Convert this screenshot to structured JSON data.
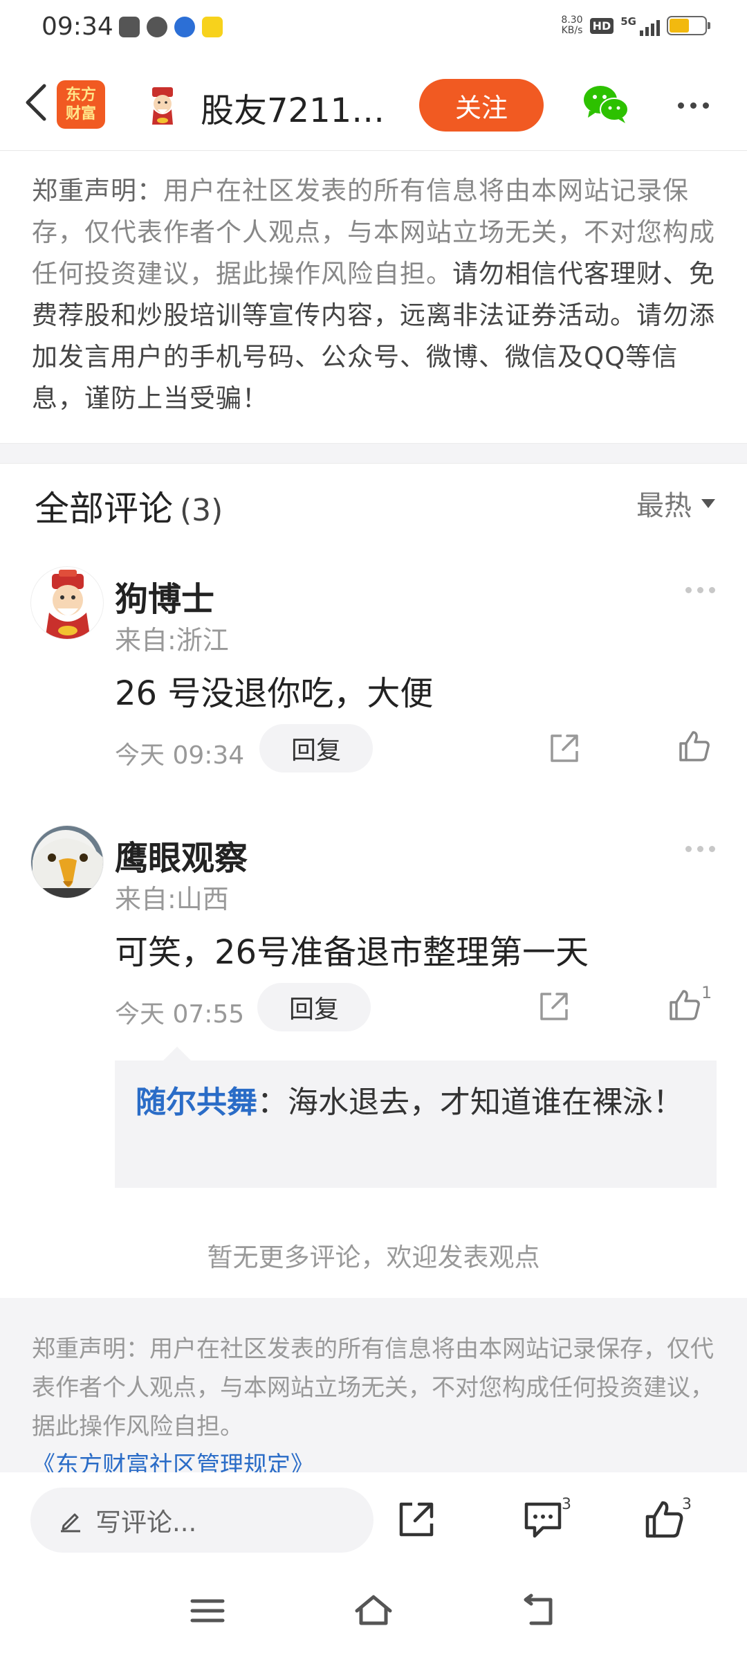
{
  "status_bar": {
    "time": "09:34",
    "net_speed_value": "8.30",
    "net_speed_unit": "KB/s",
    "hd": "HD",
    "signal": "5G"
  },
  "header": {
    "logo_line1": "东方",
    "logo_line2": "财富",
    "title": "股友7211…",
    "follow_label": "关注"
  },
  "disclaimer_top": {
    "head": "郑重声明：",
    "body": "用户在社区发表的所有信息将由本网站记录保存，仅代表作者个人观点，与本网站立场无关，不对您构成任何投资建议，据此操作风险自担。",
    "warning": "请勿相信代客理财、免费荐股和炒股培训等宣传内容，远离非法证券活动。请勿添加发言用户的手机号码、公众号、微博、微信及QQ等信息，谨防上当受骗！"
  },
  "comments_header": {
    "title": "全部评论",
    "count": "(3)",
    "sort": "最热"
  },
  "comments": [
    {
      "name": "狗博士",
      "location": "来自:浙江",
      "text": "26 号没退你吃，大便",
      "time": "今天 09:34",
      "reply_label": "回复",
      "likes": ""
    },
    {
      "name": "鹰眼观察",
      "location": "来自:山西",
      "text": "可笑，26号准备退市整理第一天",
      "time": "今天 07:55",
      "reply_label": "回复",
      "likes": "1",
      "reply": {
        "user": "随尔共舞",
        "text": "：海水退去，才知道谁在裸泳！"
      }
    }
  ],
  "no_more_text": "暂无更多评论，欢迎发表观点",
  "bottom_disclaimer": {
    "text": "郑重声明：用户在社区发表的所有信息将由本网站记录保存，仅代表作者个人观点，与本网站立场无关，不对您构成任何投资建议，据此操作风险自担。",
    "link": "《东方财富社区管理规定》"
  },
  "action_bar": {
    "placeholder": "写评论...",
    "comment_count": "3",
    "like_count": "3"
  },
  "colors": {
    "brand_orange": "#f15a22",
    "link_blue": "#2a6cc7",
    "wechat_green": "#2dc100"
  },
  "icons": [
    "back-arrow-icon",
    "wechat-icon",
    "more-dots-icon",
    "share-icon",
    "thumbs-up-icon",
    "pencil-icon",
    "comment-bubble-icon",
    "menu-icon",
    "home-icon",
    "return-icon"
  ]
}
